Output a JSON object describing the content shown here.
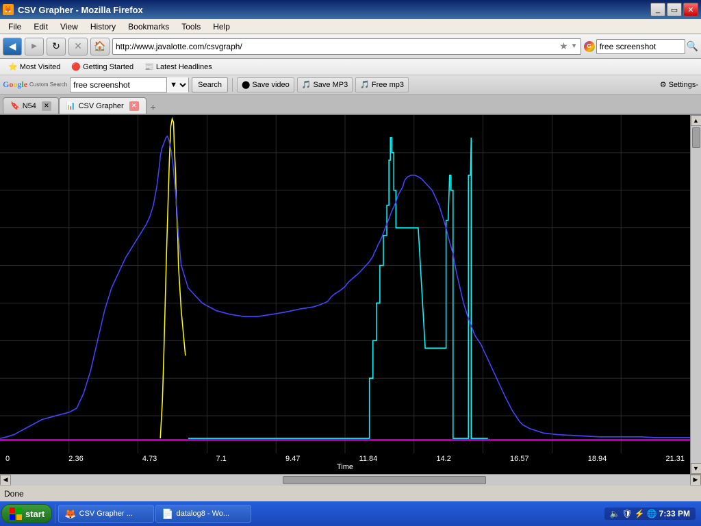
{
  "window": {
    "title": "CSV Grapher - Mozilla Firefox",
    "icon": "🦊"
  },
  "menu": {
    "items": [
      "File",
      "Edit",
      "View",
      "History",
      "Bookmarks",
      "Tools",
      "Help"
    ]
  },
  "navbar": {
    "back_label": "◀",
    "forward_label": "▶",
    "refresh_label": "↻",
    "stop_label": "✕",
    "home_label": "🏠",
    "address": "http://www.javalotte.com/csvgraph/",
    "search_placeholder": "free screenshot"
  },
  "bookmarks": {
    "items": [
      {
        "label": "Most Visited",
        "icon": "⭐"
      },
      {
        "label": "Getting Started",
        "icon": "🔴"
      },
      {
        "label": "Latest Headlines",
        "icon": "📰"
      }
    ]
  },
  "google_toolbar": {
    "search_text": "free screenshot",
    "search_btn": "Search",
    "save_video_btn": "Save video",
    "save_mp3_btn": "Save MP3",
    "free_mp3_btn": "Free mp3",
    "settings_btn": "Settings-"
  },
  "tabs": {
    "items": [
      {
        "label": "N54",
        "icon": "🔖",
        "active": false
      },
      {
        "label": "CSV Grapher",
        "icon": "📊",
        "active": true
      }
    ]
  },
  "graph": {
    "title": "CSV Grapher",
    "x_axis_label": "Time",
    "x_ticks": [
      "0",
      "2.36",
      "4.73",
      "7.1",
      "9.47",
      "11.84",
      "14.2",
      "16.57",
      "18.94",
      "21.31"
    ]
  },
  "status_bar": {
    "text": "Done"
  },
  "taskbar": {
    "start_label": "start",
    "items": [
      {
        "label": "CSV Grapher ...",
        "icon": "🦊"
      },
      {
        "label": "datalog8 - Wo...",
        "icon": "📄"
      }
    ],
    "clock": "7:33 PM"
  }
}
